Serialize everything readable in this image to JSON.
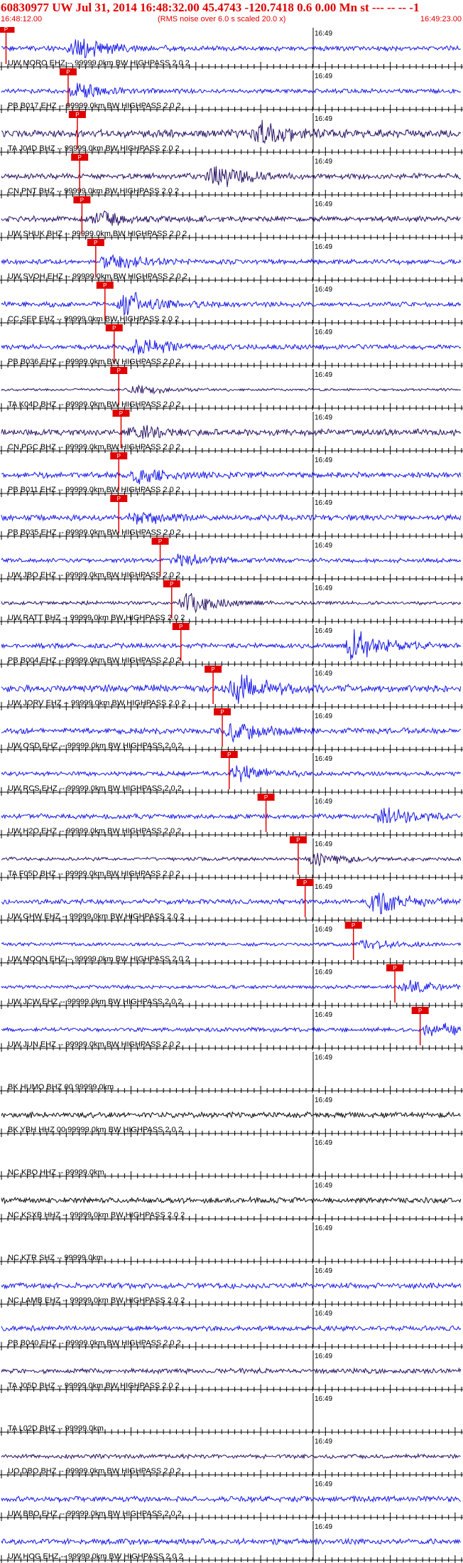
{
  "header": {
    "event_title": "60830977 UW Jul 31, 2014 16:48:32.00   45.4743 -120.7418  0.6 0.00 Mn st --- -- --   -1",
    "start_time": "16:48:12.00",
    "rms_note": "(RMS noise over 6.0 s scaled 20.0 x)",
    "end_time": "16:49:23.00"
  },
  "minute_label": "16:49",
  "pick_label": "P",
  "colors": {
    "title_red": "#e00000",
    "trace_blue": "#1a1ae6",
    "trace_navy": "#2a1466",
    "trace_black": "#111111",
    "pick_red": "#e00000",
    "axis": "#000000"
  },
  "traces": [
    {
      "label": "UW MORO EHZ -- 99999.0km BW  HIGHPASS  2.0  2",
      "color": "blue",
      "amp": 0.35,
      "pick": 0.01,
      "event": 0.15,
      "eamp": 2.0
    },
    {
      "label": "PB B017 EHZ -- 99999.0km BW  HIGHPASS  2.0  2",
      "color": "blue",
      "amp": 0.3,
      "pick": 0.145,
      "event": 0.15,
      "eamp": 1.4
    },
    {
      "label": "TA J04D BHZ -- 99999.0km BW  HIGHPASS  2.0  2",
      "color": "navy",
      "amp": 0.55,
      "pick": 0.165,
      "event": 0.55,
      "eamp": 2.4
    },
    {
      "label": "CN PNT BHZ -- 99999.0km BW  HIGHPASS  2.0  2",
      "color": "navy",
      "amp": 0.4,
      "pick": 0.17,
      "event": 0.45,
      "eamp": 2.2
    },
    {
      "label": "UW SHUK BHZ -- 99999.0km BW  HIGHPASS  2.0  2",
      "color": "navy",
      "amp": 0.4,
      "pick": 0.175,
      "event": 0.2,
      "eamp": 1.5
    },
    {
      "label": "UW SVOH EHZ -- 99999.0km BW  HIGHPASS  2.0  2",
      "color": "blue",
      "amp": 0.35,
      "pick": 0.205,
      "event": 0.22,
      "eamp": 1.6
    },
    {
      "label": "CC SEP EHZ -- 99999.0km BW  HIGHPASS  2.0  2",
      "color": "blue",
      "amp": 0.35,
      "pick": 0.225,
      "event": 0.26,
      "eamp": 2.4
    },
    {
      "label": "PB B036 EHZ -- 99999.0km BW  HIGHPASS  2.0  2",
      "color": "blue",
      "amp": 0.35,
      "pick": 0.245,
      "event": 0.28,
      "eamp": 1.8
    },
    {
      "label": "TA K04D BHZ -- 99999.0km BW  HIGHPASS  2.0  2",
      "color": "navy",
      "amp": 0.18,
      "pick": 0.255,
      "event": 0.28,
      "eamp": 1.0
    },
    {
      "label": "CN PGC BHZ -- 99999.0km BW  HIGHPASS  2.0  2",
      "color": "navy",
      "amp": 0.45,
      "pick": 0.26,
      "event": 0.28,
      "eamp": 1.2
    },
    {
      "label": "PB B011 EHZ -- 99999.0km BW  HIGHPASS  2.0  2",
      "color": "blue",
      "amp": 0.4,
      "pick": 0.255,
      "event": 0.28,
      "eamp": 1.4
    },
    {
      "label": "PB B035 EHZ -- 99999.0km BW  HIGHPASS  2.0  2",
      "color": "blue",
      "amp": 0.4,
      "pick": 0.255,
      "event": 0.28,
      "eamp": 1.2
    },
    {
      "label": "UW JBO EHZ -- 99999.0km BW  HIGHPASS  2.0  2",
      "color": "blue",
      "amp": 0.3,
      "pick": 0.345,
      "event": 0.37,
      "eamp": 1.4
    },
    {
      "label": "UW RATT BHZ -- 99999.0km BW  HIGHPASS  2.0  2",
      "color": "navy",
      "amp": 0.25,
      "pick": 0.37,
      "event": 0.39,
      "eamp": 2.0
    },
    {
      "label": "PB B004 EHZ -- 99999.0km BW  HIGHPASS  2.0  2",
      "color": "blue",
      "amp": 0.35,
      "pick": 0.39,
      "event": 0.75,
      "eamp": 3.2
    },
    {
      "label": "UW JORV EHZ -- 99999.0km BW  HIGHPASS  2.0  2",
      "color": "blue",
      "amp": 0.5,
      "pick": 0.46,
      "event": 0.5,
      "eamp": 3.4
    },
    {
      "label": "UW OSD EHZ -- 99999.0km BW  HIGHPASS  2.0  2",
      "color": "blue",
      "amp": 0.4,
      "pick": 0.48,
      "event": 0.49,
      "eamp": 2.0
    },
    {
      "label": "UW RCS EHZ -- 99999.0km BW  HIGHPASS  2.0  2",
      "color": "blue",
      "amp": 0.3,
      "pick": 0.495,
      "event": 0.5,
      "eamp": 1.6
    },
    {
      "label": "UW H2O EHZ -- 99999.0km BW  HIGHPASS  2.0  2",
      "color": "blue",
      "amp": 0.35,
      "pick": 0.575,
      "event": 0.82,
      "eamp": 2.0
    },
    {
      "label": "TA F05D BHZ -- 99999.0km BW  HIGHPASS  2.0  2",
      "color": "navy",
      "amp": 0.25,
      "pick": 0.645,
      "event": 0.67,
      "eamp": 1.4
    },
    {
      "label": "UW GHW EHZ -- 99999.0km BW  HIGHPASS  2.0  2",
      "color": "blue",
      "amp": 0.35,
      "pick": 0.66,
      "event": 0.8,
      "eamp": 2.4
    },
    {
      "label": "UW MOON EHZ -- 99999.0km BW  HIGHPASS  2.0  2",
      "color": "blue",
      "amp": 0.25,
      "pick": 0.765,
      "event": 0.78,
      "eamp": 0.9
    },
    {
      "label": "UW JCW EHZ -- 99999.0km BW  HIGHPASS  2.0  2",
      "color": "blue",
      "amp": 0.25,
      "pick": 0.855,
      "event": 0.87,
      "eamp": 1.1
    },
    {
      "label": "UW JUN EHZ -- 99999.0km BW  HIGHPASS  2.0  2",
      "color": "blue",
      "amp": 0.3,
      "pick": 0.91,
      "event": 0.92,
      "eamp": 1.6
    },
    {
      "label": "BK HUMO BHZ 00 99999.0km",
      "color": "blue",
      "amp": 0.0,
      "pick": null
    },
    {
      "label": "BK YBH HHZ 00 99999.0km BW  HIGHPASS  2.0  2",
      "color": "black",
      "amp": 0.4,
      "pick": null
    },
    {
      "label": "NC KBO HHZ -- 99999.0km",
      "color": "blue",
      "amp": 0.0,
      "pick": null
    },
    {
      "label": "NC KSXB HHZ -- 99999.0km BW  HIGHPASS  2.0  2",
      "color": "black",
      "amp": 0.4,
      "pick": null
    },
    {
      "label": "NC KTR SHZ -- 99999.0km",
      "color": "blue",
      "amp": 0.0,
      "pick": null
    },
    {
      "label": "NC LAMB EHZ -- 99999.0km BW  HIGHPASS  2.0  2",
      "color": "blue",
      "amp": 0.4,
      "pick": null
    },
    {
      "label": "PB B040 EHZ -- 99999.0km BW  HIGHPASS  2.0  2",
      "color": "blue",
      "amp": 0.35,
      "pick": null
    },
    {
      "label": "TA J05D BHZ -- 99999.0km BW  HIGHPASS  2.0  2",
      "color": "navy",
      "amp": 0.35,
      "pick": null
    },
    {
      "label": "TA L02D BHZ -- 99999.0km",
      "color": "blue",
      "amp": 0.0,
      "pick": null
    },
    {
      "label": "UO DBO BHZ -- 99999.0km BW  HIGHPASS  2.0  2",
      "color": "navy",
      "amp": 0.3,
      "pick": null
    },
    {
      "label": "UW BBO EHZ -- 99999.0km BW  HIGHPASS  2.0  2",
      "color": "blue",
      "amp": 0.4,
      "pick": null
    },
    {
      "label": "UW HOG EHZ -- 99999.0km BW  HIGHPASS  2.0  2",
      "color": "blue",
      "amp": 0.4,
      "pick": null
    }
  ]
}
